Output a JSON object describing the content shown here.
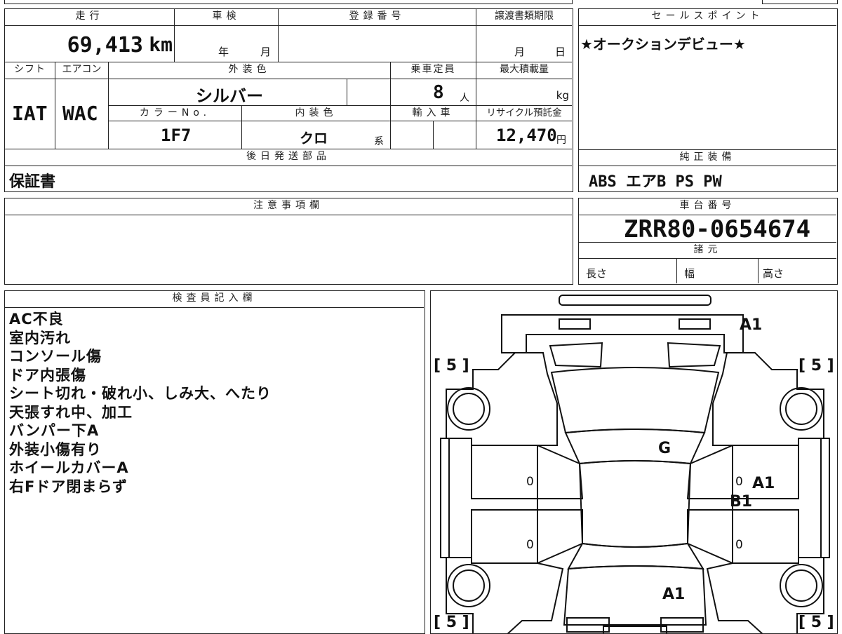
{
  "mileage": {
    "header": "走行",
    "value": "69,413",
    "unit": "km"
  },
  "inspection": {
    "header": "車検",
    "year": "年",
    "month": "月"
  },
  "registration": {
    "header": "登録番号",
    "value": ""
  },
  "transfer": {
    "header": "譲渡書類期限",
    "month": "月",
    "day": "日"
  },
  "sales_point": {
    "header": "セールスポイント",
    "text": "★オークションデビュー★"
  },
  "shift": {
    "header": "シフト",
    "value": "IAT"
  },
  "aircon": {
    "header": "エアコン",
    "value": "WAC"
  },
  "exterior_color": {
    "header": "外装色",
    "value": "シルバー"
  },
  "capacity": {
    "header": "乗車定員",
    "value": "8",
    "unit": "人"
  },
  "max_load": {
    "header": "最大積載量",
    "unit": "kg"
  },
  "color_no": {
    "header": "カラーNo.",
    "value": "1F7"
  },
  "interior_color": {
    "header": "内装色",
    "value": "クロ",
    "suffix": "系"
  },
  "import": {
    "header": "輸入車"
  },
  "recycle": {
    "header": "リサイクル預託金",
    "value": "12,470",
    "unit": "円"
  },
  "later_parts": {
    "header": "後日発送部品",
    "value": "保証書"
  },
  "genuine": {
    "header": "純正装備",
    "value": "ABS エアB PS PW"
  },
  "notes": {
    "header": "注意事項欄"
  },
  "chassis": {
    "header": "車台番号",
    "value": "ZRR80-0654674"
  },
  "specs": {
    "header": "諸元",
    "length": "長さ",
    "width": "幅",
    "height": "高さ"
  },
  "inspector": {
    "header": "検査員記入欄",
    "lines": [
      "AC不良",
      "室内汚れ",
      "コンソール傷",
      "ドア内張傷",
      "シート切れ・破れ小、しみ大、へたり",
      "天張すれ中、加工",
      "バンパー下A",
      "外装小傷有り",
      "ホイールカバーA",
      "右Fドア閉まらず"
    ]
  },
  "diagram": {
    "tires": {
      "fl": "[ 5 ]",
      "fr": "[ 5 ]",
      "rl": "[ 5 ]",
      "rr": "[ 5 ]"
    },
    "marks": {
      "front_bumper": "A1",
      "windshield": "G",
      "right_door": "A1",
      "right_sill": "B1",
      "rear": "A1"
    },
    "zeros": {
      "lf": "0",
      "lr": "0",
      "rf": "0",
      "rr": "0"
    }
  }
}
